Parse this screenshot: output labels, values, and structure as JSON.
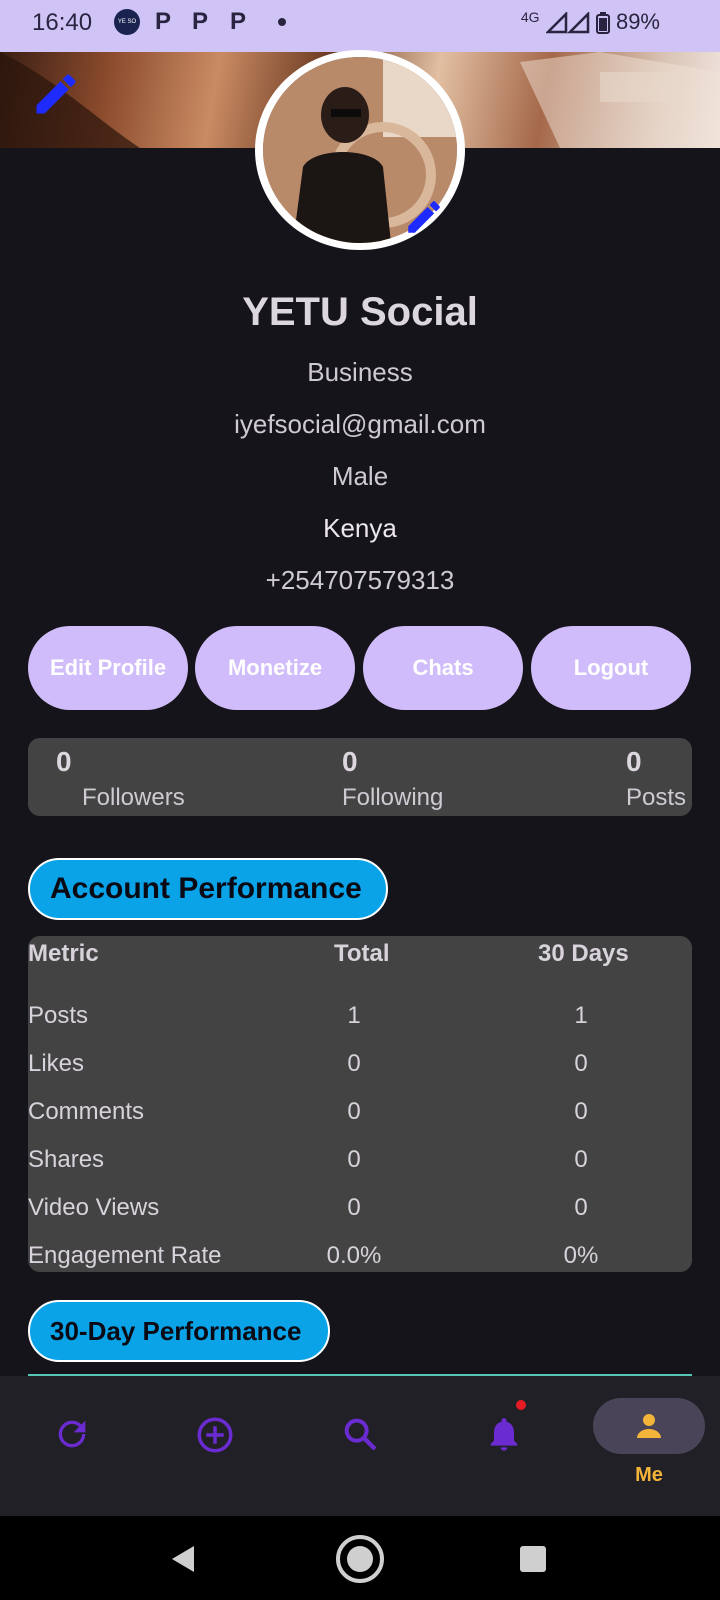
{
  "status_bar": {
    "time": "16:40",
    "round_icon_text": "YE SO",
    "p_icons": [
      "P",
      "P",
      "P"
    ],
    "network": "4G",
    "battery": "89%"
  },
  "profile": {
    "name": "YETU Social",
    "account_type": "Business",
    "email": "iyefsocial@gmail.com",
    "gender": "Male",
    "country": "Kenya",
    "phone": "+254707579313"
  },
  "actions": [
    {
      "label": "Edit Profile"
    },
    {
      "label": "Monetize"
    },
    {
      "label": "Chats"
    },
    {
      "label": "Logout"
    }
  ],
  "stats": [
    {
      "value": "0",
      "label": "Followers"
    },
    {
      "value": "0",
      "label": "Following"
    },
    {
      "value": "0",
      "label": "Posts"
    }
  ],
  "account_performance": {
    "title": "Account Performance",
    "headers": [
      "Metric",
      "Total",
      "30 Days"
    ],
    "rows": [
      [
        "Posts",
        "1",
        "1"
      ],
      [
        "Likes",
        "0",
        "0"
      ],
      [
        "Comments",
        "0",
        "0"
      ],
      [
        "Shares",
        "0",
        "0"
      ],
      [
        "Video Views",
        "0",
        "0"
      ],
      [
        "Engagement Rate",
        "0.0%",
        "0%"
      ]
    ]
  },
  "thirty_day_performance": {
    "title": "30-Day Performance"
  },
  "bottom_nav": {
    "items": [
      {
        "icon": "refresh-icon"
      },
      {
        "icon": "add-circle-icon"
      },
      {
        "icon": "search-icon"
      },
      {
        "icon": "notifications-icon"
      },
      {
        "icon": "person-icon",
        "label": "Me"
      }
    ]
  },
  "colors": {
    "accent_purple": "#d0bcfa",
    "pill_blue": "#0aa3e8",
    "nav_icon": "#6a2bd0",
    "me_active": "#f2b53a"
  }
}
